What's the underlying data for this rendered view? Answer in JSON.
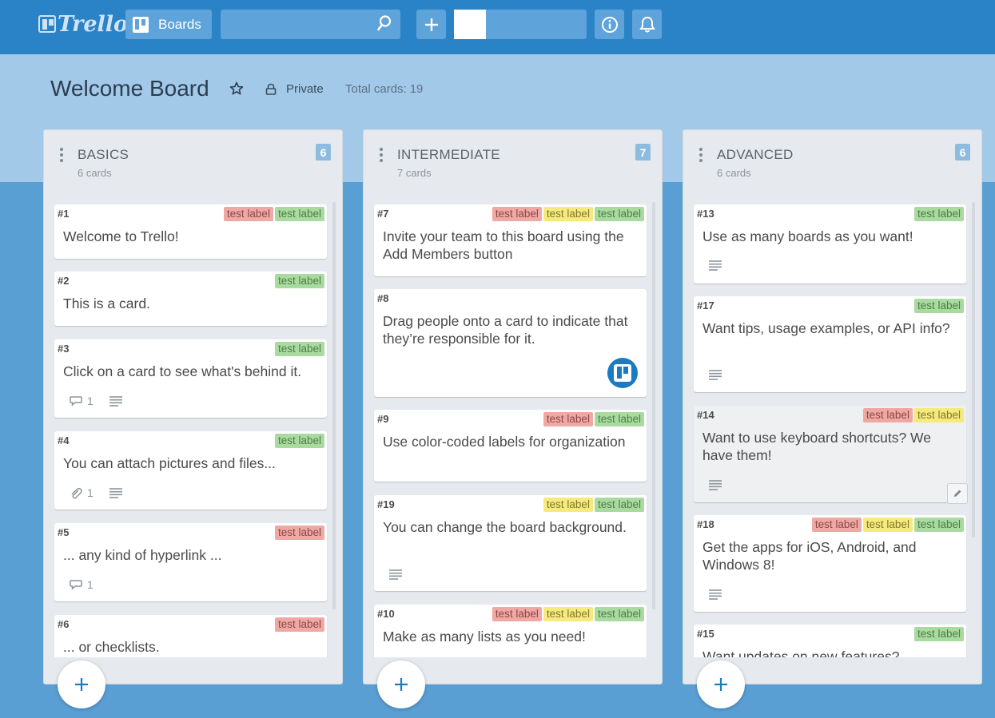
{
  "app": {
    "logo_text": "Trello",
    "boards_label": "Boards",
    "search_placeholder": "",
    "colors": {
      "topbar": "#2a83c6",
      "header": "#a3c9e8",
      "background": "#5a9fd4",
      "accent": "#1a7bc2"
    }
  },
  "board": {
    "title": "Welcome Board",
    "visibility": "Private",
    "total_cards_label": "Total cards:",
    "total_cards": "19"
  },
  "lists": [
    {
      "name": "BASICS",
      "subtitle": "6 cards",
      "count": "6",
      "cards": [
        {
          "num": "#1",
          "text": "Welcome to Trello!",
          "labels": [
            {
              "text": "test label",
              "color": "red"
            },
            {
              "text": "test label",
              "color": "green"
            }
          ]
        },
        {
          "num": "#2",
          "text": "This is a card.",
          "labels": [
            {
              "text": "test label",
              "color": "green"
            }
          ]
        },
        {
          "num": "#3",
          "text": "Click on a card to see what's behind it.",
          "labels": [
            {
              "text": "test label",
              "color": "green"
            }
          ],
          "comments": "1",
          "description": true
        },
        {
          "num": "#4",
          "text": "You can attach pictures and files...",
          "labels": [
            {
              "text": "test label",
              "color": "green"
            }
          ],
          "attachments": "1",
          "description": true
        },
        {
          "num": "#5",
          "text": "... any kind of hyperlink ...",
          "labels": [
            {
              "text": "test label",
              "color": "red"
            }
          ],
          "comments": "1"
        },
        {
          "num": "#6",
          "text": "... or checklists.",
          "labels": [
            {
              "text": "test label",
              "color": "red"
            }
          ]
        }
      ]
    },
    {
      "name": "INTERMEDIATE",
      "subtitle": "7 cards",
      "count": "7",
      "cards": [
        {
          "num": "#7",
          "text": "Invite your team to this board using the Add Members button",
          "labels": [
            {
              "text": "test label",
              "color": "red"
            },
            {
              "text": "test label",
              "color": "yellow"
            },
            {
              "text": "test label",
              "color": "green"
            }
          ]
        },
        {
          "num": "#8",
          "text": "Drag people onto a card to indicate that they’re responsible for it.",
          "labels": [],
          "member": true
        },
        {
          "num": "#9",
          "text": "Use color-coded labels for organization",
          "labels": [
            {
              "text": "test label",
              "color": "red"
            },
            {
              "text": "test label",
              "color": "green"
            }
          ]
        },
        {
          "num": "#19",
          "text": "You can change the board background.",
          "labels": [
            {
              "text": "test label",
              "color": "yellow"
            },
            {
              "text": "test label",
              "color": "green"
            }
          ],
          "description": true
        },
        {
          "num": "#10",
          "text": "Make as many lists as you need!",
          "labels": [
            {
              "text": "test label",
              "color": "red"
            },
            {
              "text": "test label",
              "color": "yellow"
            },
            {
              "text": "test label",
              "color": "green"
            }
          ]
        }
      ]
    },
    {
      "name": "ADVANCED",
      "subtitle": "6 cards",
      "count": "6",
      "cards": [
        {
          "num": "#13",
          "text": "Use as many boards as you want!",
          "labels": [
            {
              "text": "test label",
              "color": "green"
            }
          ],
          "description": true
        },
        {
          "num": "#17",
          "text": "Want tips, usage examples, or API info?",
          "labels": [
            {
              "text": "test label",
              "color": "green"
            }
          ],
          "description": true
        },
        {
          "num": "#14",
          "text": "Want to use keyboard shortcuts? We have them!",
          "labels": [
            {
              "text": "test label",
              "color": "red"
            },
            {
              "text": "test label",
              "color": "yellow"
            }
          ],
          "description": true,
          "hover": true
        },
        {
          "num": "#18",
          "text": "Get the apps for iOS, Android, and Windows 8!",
          "labels": [
            {
              "text": "test label",
              "color": "red"
            },
            {
              "text": "test label",
              "color": "yellow"
            },
            {
              "text": "test label",
              "color": "green"
            }
          ],
          "description": true
        },
        {
          "num": "#15",
          "text": "Want updates on new features?",
          "labels": [
            {
              "text": "test label",
              "color": "green"
            }
          ]
        }
      ]
    }
  ]
}
